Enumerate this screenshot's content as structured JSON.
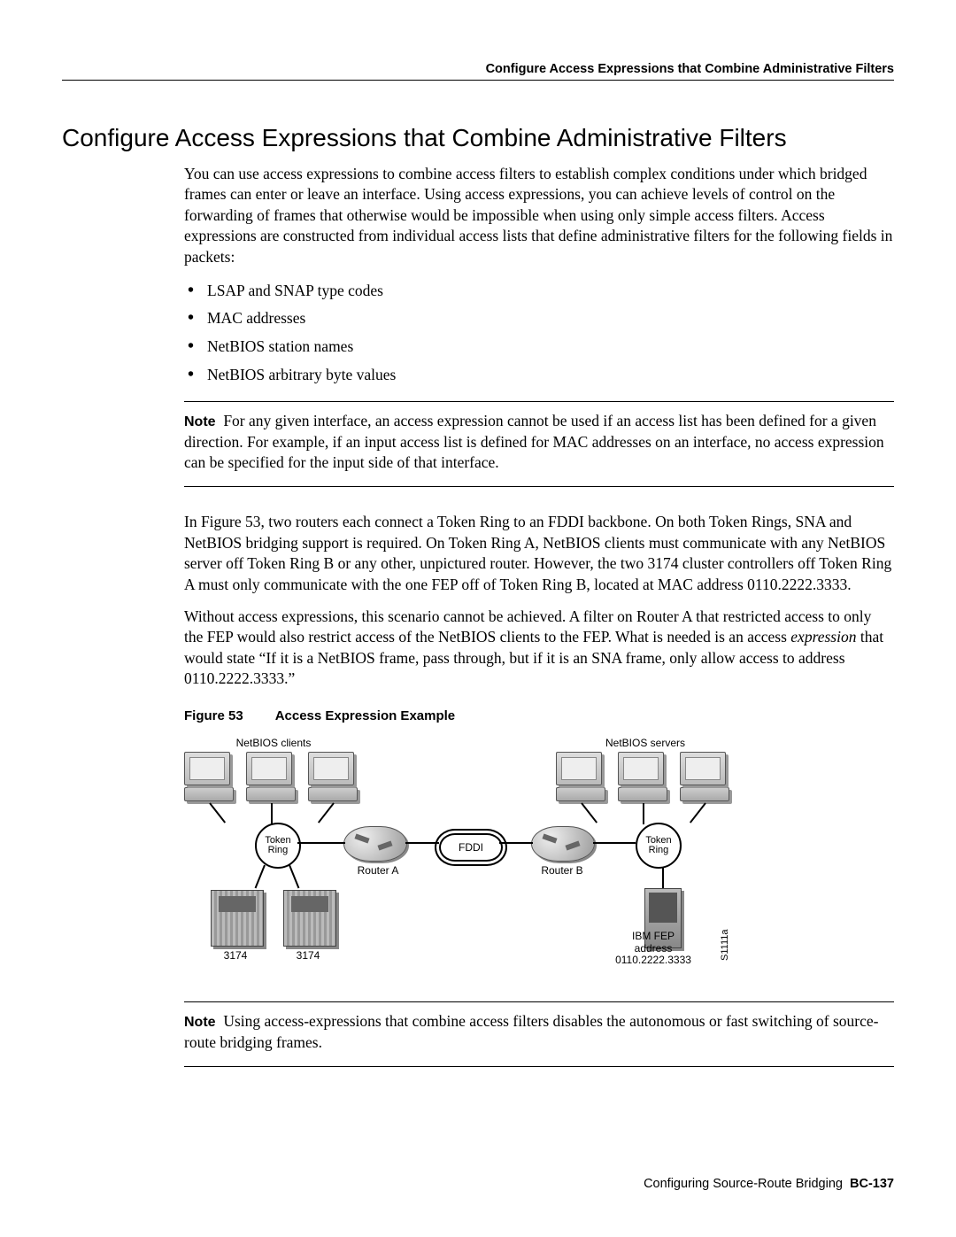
{
  "running_head": "Configure Access Expressions that Combine Administrative Filters",
  "section_title": "Configure Access Expressions that Combine Administrative Filters",
  "intro": "You can use access expressions to combine access filters to establish complex conditions under which bridged frames can enter or leave an interface. Using access expressions, you can achieve levels of control on the forwarding of frames that otherwise would be impossible when using only simple access filters. Access expressions are constructed from individual access lists that define administrative filters for the following fields in packets:",
  "bullets": [
    "LSAP and SNAP type codes",
    "MAC addresses",
    "NetBIOS station names",
    "NetBIOS arbitrary byte values"
  ],
  "note1_label": "Note",
  "note1_text": "For any given interface, an access expression cannot be used if an access list has been defined for a given direction. For example, if an input access list is defined for MAC addresses on an interface, no access expression can be specified for the input side of that interface.",
  "para2": "In Figure 53, two routers each connect a Token Ring to an FDDI backbone. On both Token Rings, SNA and NetBIOS bridging support is required. On Token Ring A, NetBIOS clients must communicate with any NetBIOS server off Token Ring B or any other, unpictured router. However, the two 3174 cluster controllers off Token Ring A must only communicate with the one FEP off of Token Ring B, located at MAC address 0110.2222.3333.",
  "para3_pre": "Without access expressions, this scenario cannot be achieved. A filter on Router A that restricted access to only the FEP would also restrict access of the NetBIOS clients to the FEP. What is needed is an access ",
  "para3_em": "expression",
  "para3_post": " that would state “If it is a NetBIOS frame, pass through, but if it is an SNA frame, only allow access to address 0110.2222.3333.”",
  "figure": {
    "label": "Figure 53",
    "title": "Access Expression Example",
    "netbios_clients": "NetBIOS clients",
    "netbios_servers": "NetBIOS servers",
    "token_ring": "Token\nRing",
    "fddi": "FDDI",
    "router_a": "Router A",
    "router_b": "Router B",
    "c3174": "3174",
    "fep_line1": "IBM FEP",
    "fep_line2": "address",
    "fep_line3": "0110.2222.3333",
    "sideid": "S1111a"
  },
  "note2_label": "Note",
  "note2_text": "Using access-expressions that combine access filters disables the autonomous or fast switching of source-route bridging frames.",
  "footer_text": "Configuring Source-Route Bridging",
  "footer_page": "BC-137"
}
